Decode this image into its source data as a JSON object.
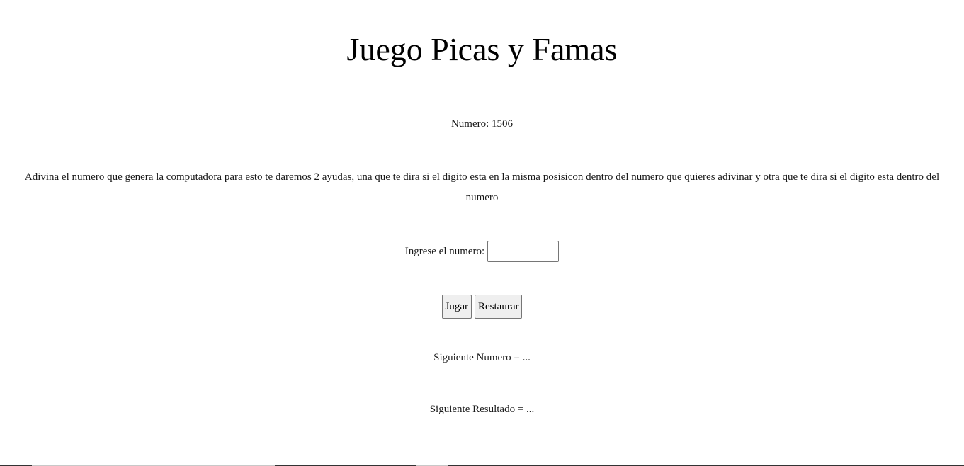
{
  "title": "Juego Picas y Famas",
  "numero_text": "Numero: 1506",
  "description": "Adivina el numero que genera la computadora para esto te daremos 2 ayudas, una que te dira si el digito esta en la misma posisicon dentro del numero que quieres adivinar y otra que te dira si el digito esta dentro del numero",
  "input": {
    "label": "Ingrese el numero:",
    "value": "",
    "placeholder": ""
  },
  "buttons": {
    "play_label": "Jugar",
    "reset_label": "Restaurar"
  },
  "siguiente_numero": "Siguiente Numero = ...",
  "siguiente_resultado": "Siguiente Resultado = ..."
}
